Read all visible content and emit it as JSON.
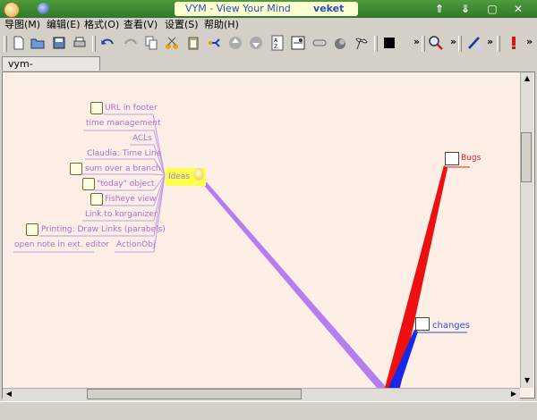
{
  "window": {
    "title": "VYM - View Your Mind",
    "user": "veket"
  },
  "menu": [
    {
      "label": "导图(M)"
    },
    {
      "label": "编辑(E)"
    },
    {
      "label": "格式(O)"
    },
    {
      "label": "查看(V)"
    },
    {
      "label": "设置(S)"
    },
    {
      "label": "帮助(H)"
    }
  ],
  "tabs": [
    {
      "label": "vym-projectplan.vym"
    }
  ],
  "toolbar": {
    "overflow": "»"
  },
  "mindmap": {
    "center": {
      "label": "Ideas"
    },
    "branches": [
      {
        "label": "URL in footer",
        "note": true
      },
      {
        "label": "time management",
        "note": false
      },
      {
        "label": "ACLs",
        "note": false
      },
      {
        "label": "Claudia: Time Line",
        "note": false
      },
      {
        "label": "sum over a branch",
        "note": true
      },
      {
        "label": "\"today\" object",
        "note": true
      },
      {
        "label": "Fisheye view",
        "note": true
      },
      {
        "label": "Link to korganizer",
        "note": false
      },
      {
        "label": "Printing: Draw Links (parabels)",
        "note": true
      },
      {
        "label": "open note in ext. editor",
        "note": false
      },
      {
        "label": "ActionObj",
        "note": false
      }
    ],
    "right_nodes": [
      {
        "label": "Bugs",
        "color": "#e02020"
      },
      {
        "label": "changes",
        "color": "#3050e0"
      }
    ]
  }
}
